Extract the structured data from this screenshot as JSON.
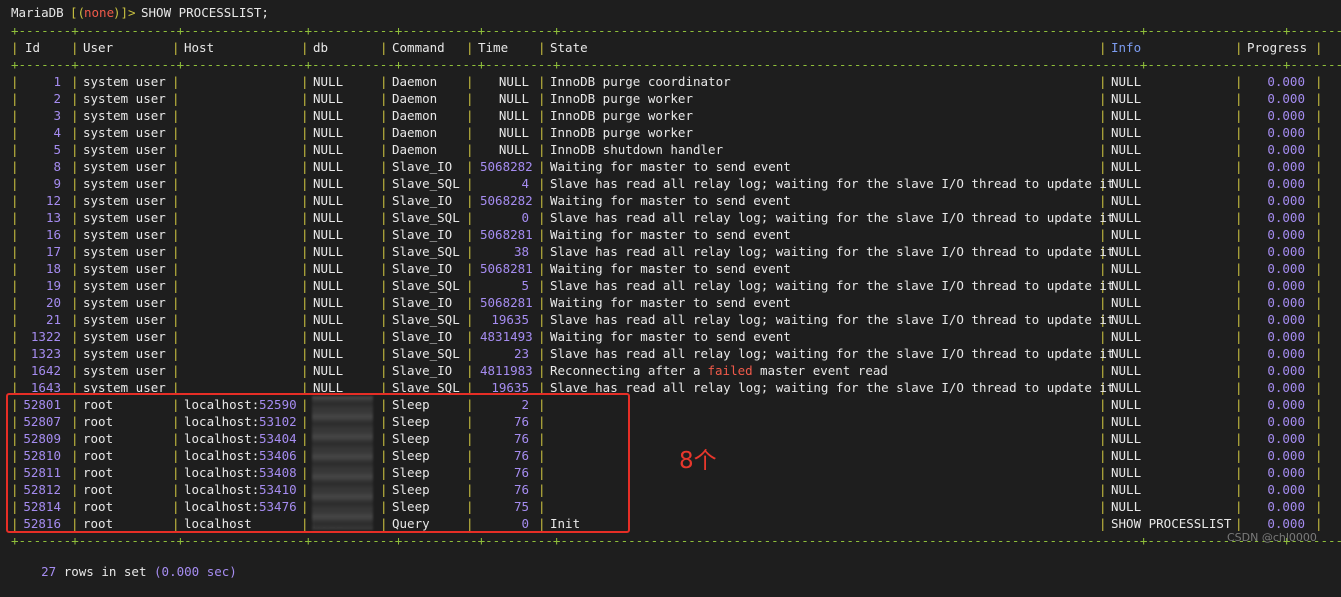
{
  "prompt": {
    "name": "MariaDB",
    "db_open": "[(",
    "db": "none",
    "db_close": ")]>",
    "command": "SHOW PROCESSLIST;"
  },
  "headers": {
    "id": "Id",
    "user": "User",
    "host": "Host",
    "db": "db",
    "command": "Command",
    "time": "Time",
    "state": "State",
    "info": "Info",
    "progress": "Progress"
  },
  "rows": [
    {
      "id": "1",
      "user": "system user",
      "host": "",
      "db": "NULL",
      "command": "Daemon",
      "time": "NULL",
      "state": "InnoDB purge coordinator",
      "info": "NULL",
      "progress": "0.000"
    },
    {
      "id": "2",
      "user": "system user",
      "host": "",
      "db": "NULL",
      "command": "Daemon",
      "time": "NULL",
      "state": "InnoDB purge worker",
      "info": "NULL",
      "progress": "0.000"
    },
    {
      "id": "3",
      "user": "system user",
      "host": "",
      "db": "NULL",
      "command": "Daemon",
      "time": "NULL",
      "state": "InnoDB purge worker",
      "info": "NULL",
      "progress": "0.000"
    },
    {
      "id": "4",
      "user": "system user",
      "host": "",
      "db": "NULL",
      "command": "Daemon",
      "time": "NULL",
      "state": "InnoDB purge worker",
      "info": "NULL",
      "progress": "0.000"
    },
    {
      "id": "5",
      "user": "system user",
      "host": "",
      "db": "NULL",
      "command": "Daemon",
      "time": "NULL",
      "state": "InnoDB shutdown handler",
      "info": "NULL",
      "progress": "0.000"
    },
    {
      "id": "8",
      "user": "system user",
      "host": "",
      "db": "NULL",
      "command": "Slave_IO",
      "time": "5068282",
      "state": "Waiting for master to send event",
      "info": "NULL",
      "progress": "0.000"
    },
    {
      "id": "9",
      "user": "system user",
      "host": "",
      "db": "NULL",
      "command": "Slave_SQL",
      "time": "4",
      "state": "Slave has read all relay log; waiting for the slave I/O thread to update it",
      "info": "NULL",
      "progress": "0.000"
    },
    {
      "id": "12",
      "user": "system user",
      "host": "",
      "db": "NULL",
      "command": "Slave_IO",
      "time": "5068282",
      "state": "Waiting for master to send event",
      "info": "NULL",
      "progress": "0.000"
    },
    {
      "id": "13",
      "user": "system user",
      "host": "",
      "db": "NULL",
      "command": "Slave_SQL",
      "time": "0",
      "state": "Slave has read all relay log; waiting for the slave I/O thread to update it",
      "info": "NULL",
      "progress": "0.000"
    },
    {
      "id": "16",
      "user": "system user",
      "host": "",
      "db": "NULL",
      "command": "Slave_IO",
      "time": "5068281",
      "state": "Waiting for master to send event",
      "info": "NULL",
      "progress": "0.000"
    },
    {
      "id": "17",
      "user": "system user",
      "host": "",
      "db": "NULL",
      "command": "Slave_SQL",
      "time": "38",
      "state": "Slave has read all relay log; waiting for the slave I/O thread to update it",
      "info": "NULL",
      "progress": "0.000"
    },
    {
      "id": "18",
      "user": "system user",
      "host": "",
      "db": "NULL",
      "command": "Slave_IO",
      "time": "5068281",
      "state": "Waiting for master to send event",
      "info": "NULL",
      "progress": "0.000"
    },
    {
      "id": "19",
      "user": "system user",
      "host": "",
      "db": "NULL",
      "command": "Slave_SQL",
      "time": "5",
      "state": "Slave has read all relay log; waiting for the slave I/O thread to update it",
      "info": "NULL",
      "progress": "0.000"
    },
    {
      "id": "20",
      "user": "system user",
      "host": "",
      "db": "NULL",
      "command": "Slave_IO",
      "time": "5068281",
      "state": "Waiting for master to send event",
      "info": "NULL",
      "progress": "0.000"
    },
    {
      "id": "21",
      "user": "system user",
      "host": "",
      "db": "NULL",
      "command": "Slave_SQL",
      "time": "19635",
      "state": "Slave has read all relay log; waiting for the slave I/O thread to update it",
      "info": "NULL",
      "progress": "0.000"
    },
    {
      "id": "1322",
      "user": "system user",
      "host": "",
      "db": "NULL",
      "command": "Slave_IO",
      "time": "4831493",
      "state": "Waiting for master to send event",
      "info": "NULL",
      "progress": "0.000"
    },
    {
      "id": "1323",
      "user": "system user",
      "host": "",
      "db": "NULL",
      "command": "Slave_SQL",
      "time": "23",
      "state": "Slave has read all relay log; waiting for the slave I/O thread to update it",
      "info": "NULL",
      "progress": "0.000"
    },
    {
      "id": "1642",
      "user": "system user",
      "host": "",
      "db": "NULL",
      "command": "Slave_IO",
      "time": "4811983",
      "state_pre": "Reconnecting after a ",
      "state_err": "failed",
      "state_post": " master event read",
      "info": "NULL",
      "progress": "0.000"
    },
    {
      "id": "1643",
      "user": "system user",
      "host": "",
      "db": "NULL",
      "command": "Slave_SQL",
      "time": "19635",
      "state": "Slave has read all relay log; waiting for the slave I/O thread to update it",
      "info": "NULL",
      "progress": "0.000"
    },
    {
      "id": "52801",
      "user": "root",
      "host": "localhost:",
      "port": "52590",
      "db": "",
      "command": "Sleep",
      "time": "2",
      "state": "",
      "info": "NULL",
      "progress": "0.000"
    },
    {
      "id": "52807",
      "user": "root",
      "host": "localhost:",
      "port": "53102",
      "db": "",
      "command": "Sleep",
      "time": "76",
      "state": "",
      "info": "NULL",
      "progress": "0.000"
    },
    {
      "id": "52809",
      "user": "root",
      "host": "localhost:",
      "port": "53404",
      "db": "",
      "command": "Sleep",
      "time": "76",
      "state": "",
      "info": "NULL",
      "progress": "0.000"
    },
    {
      "id": "52810",
      "user": "root",
      "host": "localhost:",
      "port": "53406",
      "db": "",
      "command": "Sleep",
      "time": "76",
      "state": "",
      "info": "NULL",
      "progress": "0.000"
    },
    {
      "id": "52811",
      "user": "root",
      "host": "localhost:",
      "port": "53408",
      "db": "",
      "command": "Sleep",
      "time": "76",
      "state": "",
      "info": "NULL",
      "progress": "0.000"
    },
    {
      "id": "52812",
      "user": "root",
      "host": "localhost:",
      "port": "53410",
      "db": "",
      "command": "Sleep",
      "time": "76",
      "state": "",
      "info": "NULL",
      "progress": "0.000"
    },
    {
      "id": "52814",
      "user": "root",
      "host": "localhost:",
      "port": "53476",
      "db": "",
      "command": "Sleep",
      "time": "75",
      "state": "",
      "info": "NULL",
      "progress": "0.000"
    },
    {
      "id": "52816",
      "user": "root",
      "host": "localhost",
      "port": "",
      "db": "NULL",
      "command": "Query",
      "time": "0",
      "state": "Init",
      "info": "SHOW PROCESSLIST",
      "progress": "0.000"
    }
  ],
  "annotation": "8个",
  "watermark": "CSDN @chl0000",
  "footer": {
    "count": "27",
    "text": " rows in set ",
    "time": "(0.000 sec)"
  },
  "colors": {
    "background": "#1e1e1e",
    "separator": "#8fbf3a",
    "number": "#a58cf0",
    "highlight_box": "#e62e26",
    "annotation": "#e8372c"
  }
}
